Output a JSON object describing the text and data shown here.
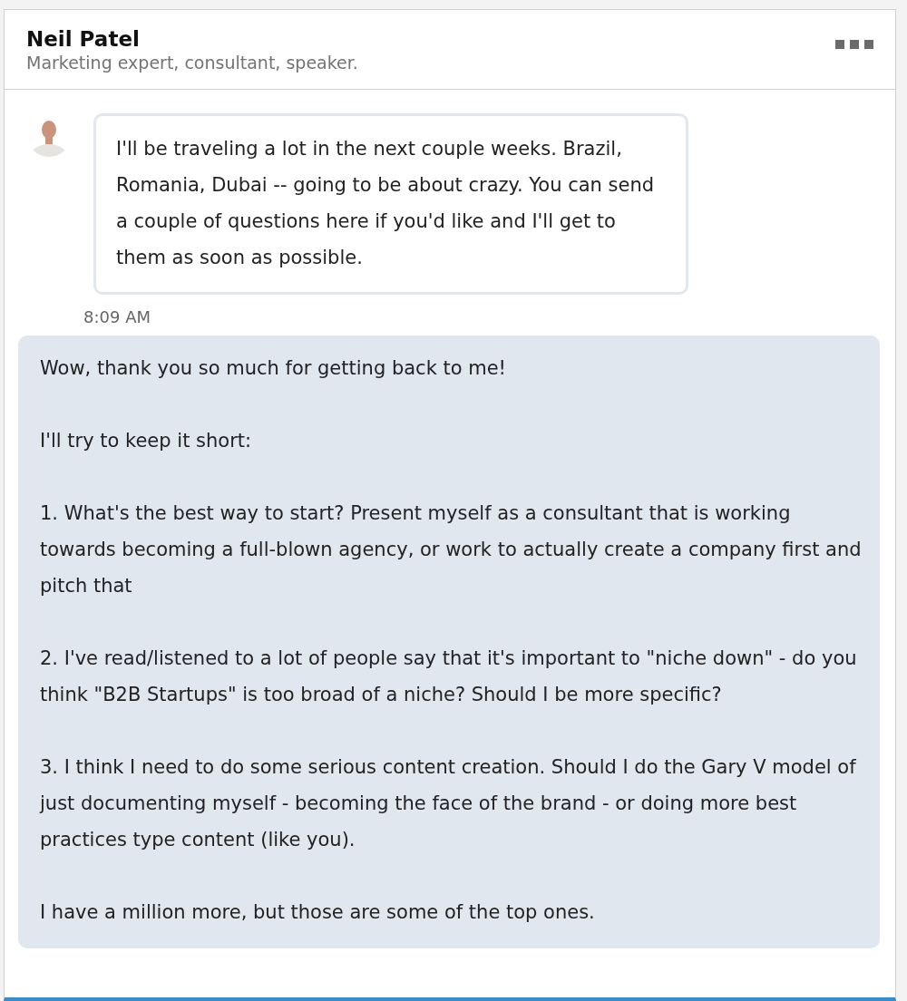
{
  "header": {
    "name": "Neil Patel",
    "headline": "Marketing expert, consultant, speaker."
  },
  "messages": [
    {
      "kind": "received",
      "paragraphs": [
        "I'll be traveling a lot in the next couple weeks. Brazil, Romania, Dubai -- going to be about crazy. You can send a couple of questions here if you'd like and I'll get to them as soon as possible."
      ],
      "time": "8:09 AM"
    },
    {
      "kind": "sent",
      "paragraphs": [
        "Wow, thank you so much for getting back to me!",
        "I'll try to keep it short:",
        "1. What's the best way to start? Present myself as a consultant that is working towards becoming a full-blown agency, or work to actually create a company first and pitch that",
        "2. I've read/listened to a lot of people say that it's important to \"niche down\" - do you think \"B2B Startups\" is too broad of a niche? Should I be more specific?",
        "3. I think I need to do some serious content creation. Should I do the Gary V model of just documenting myself - becoming the face of the brand - or doing more best practices type content (like you).",
        "I have a million more, but those are some of the top ones."
      ]
    }
  ]
}
